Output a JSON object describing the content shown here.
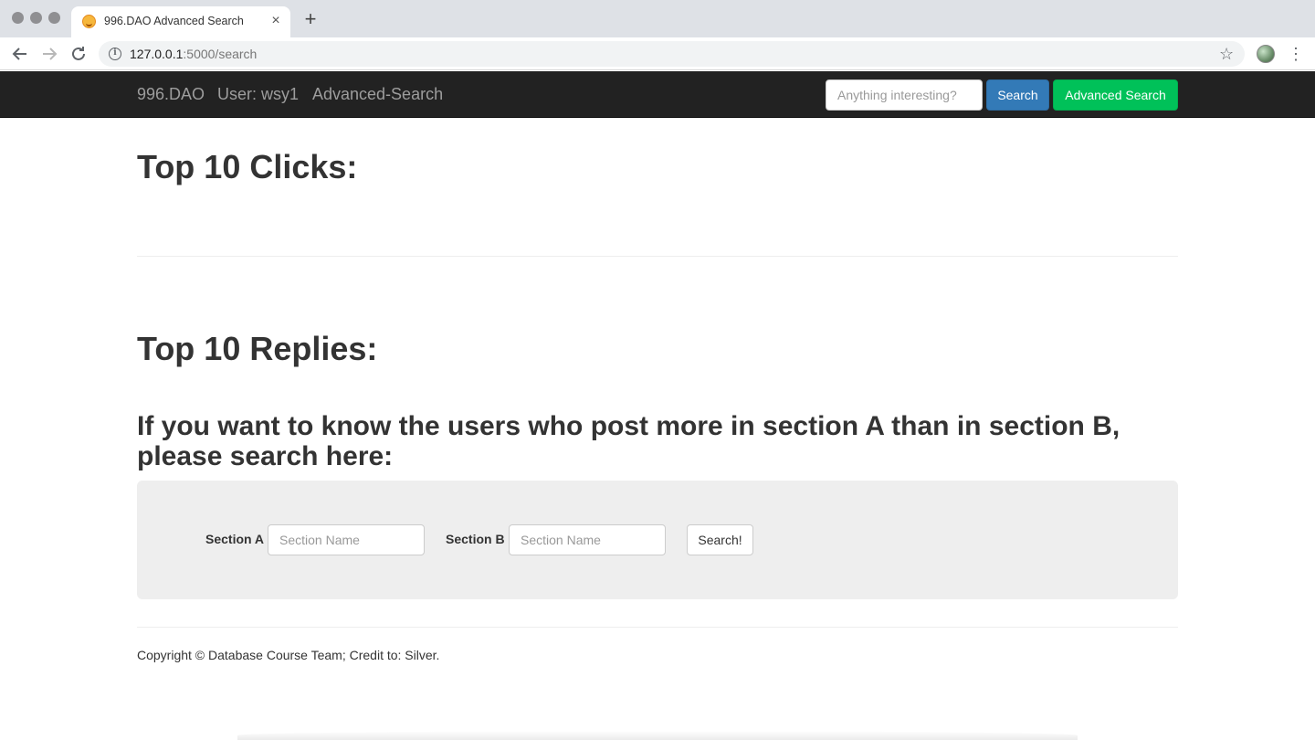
{
  "browser": {
    "tab_title": "996.DAO Advanced Search",
    "tab_close": "×",
    "new_tab": "+",
    "url_host": "127.0.0.1",
    "url_rest": ":5000/search",
    "icons": {
      "back": "arrow-left-icon",
      "forward": "arrow-right-icon",
      "reload": "reload-icon",
      "info": "info-icon",
      "bookmark": "star-icon",
      "menu": "more-vert-icon"
    }
  },
  "navbar": {
    "brand": "996.DAO",
    "user": "User: wsy1",
    "advanced_link": "Advanced-Search",
    "search_placeholder": "Anything interesting?",
    "search_button": "Search",
    "advanced_button": "Advanced Search",
    "colors": {
      "bar": "#222222",
      "primary": "#337ab7",
      "success": "#00c159"
    }
  },
  "main": {
    "top_clicks_heading": "Top 10 Clicks:",
    "top_replies_heading": "Top 10 Replies:",
    "question_heading": "If you want to know the users who post more in section A than in section B, please search here:",
    "form": {
      "section_a_label": "Section A",
      "section_a_placeholder": "Section Name",
      "section_b_label": "Section B",
      "section_b_placeholder": "Section Name",
      "submit_label": "Search!"
    }
  },
  "footer": {
    "text": "Copyright © Database Course Team; Credit to: Silver."
  }
}
